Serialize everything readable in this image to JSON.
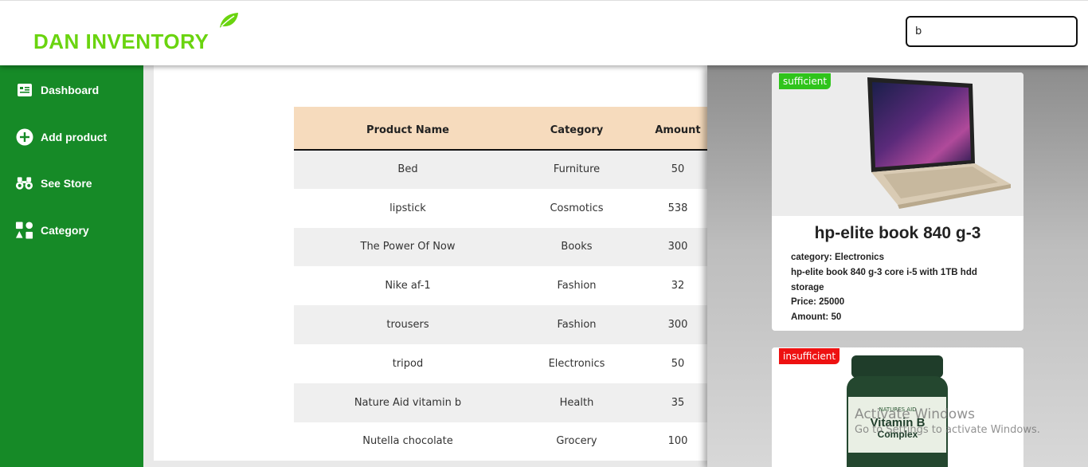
{
  "header": {
    "logo_text": "DAN INVENTORY",
    "search_value": "b"
  },
  "sidebar": {
    "items": [
      {
        "label": "Dashboard",
        "icon": "dashboard-icon"
      },
      {
        "label": "Add product",
        "icon": "plus-circle-icon"
      },
      {
        "label": "See Store",
        "icon": "binoculars-icon"
      },
      {
        "label": "Category",
        "icon": "shapes-icon"
      }
    ]
  },
  "table": {
    "columns": [
      "Product Name",
      "Category",
      "Amount"
    ],
    "rows": [
      {
        "name": "Bed",
        "category": "Furniture",
        "amount": "50"
      },
      {
        "name": "lipstick",
        "category": "Cosmotics",
        "amount": "538"
      },
      {
        "name": "The Power Of Now",
        "category": "Books",
        "amount": "300"
      },
      {
        "name": "Nike af-1",
        "category": "Fashion",
        "amount": "32"
      },
      {
        "name": "trousers",
        "category": "Fashion",
        "amount": "300"
      },
      {
        "name": "tripod",
        "category": "Electronics",
        "amount": "50"
      },
      {
        "name": "Nature Aid vitamin b",
        "category": "Health",
        "amount": "35"
      },
      {
        "name": "Nutella chocolate",
        "category": "Grocery",
        "amount": "100"
      }
    ]
  },
  "results": [
    {
      "status": "sufficient",
      "title": "hp-elite book 840 g-3",
      "category": "category: Electronics",
      "description": "hp-elite book 840 g-3 core i-5 with 1TB hdd storage",
      "price": "Price: 25000",
      "amount": "Amount: 50"
    },
    {
      "status": "insufficient",
      "label_top": "NATURES AID",
      "label_main": "Vitamin B",
      "label_sub": "Complex"
    }
  ],
  "watermark": {
    "line1": "Activate Windows",
    "line2": "Go to Settings to activate Windows."
  },
  "colors": {
    "sidebar": "#168a27",
    "logo": "#6ad40f",
    "table_header": "#f6dbbd",
    "badge_ok": "#2fc41b",
    "badge_bad": "#ee1111"
  }
}
